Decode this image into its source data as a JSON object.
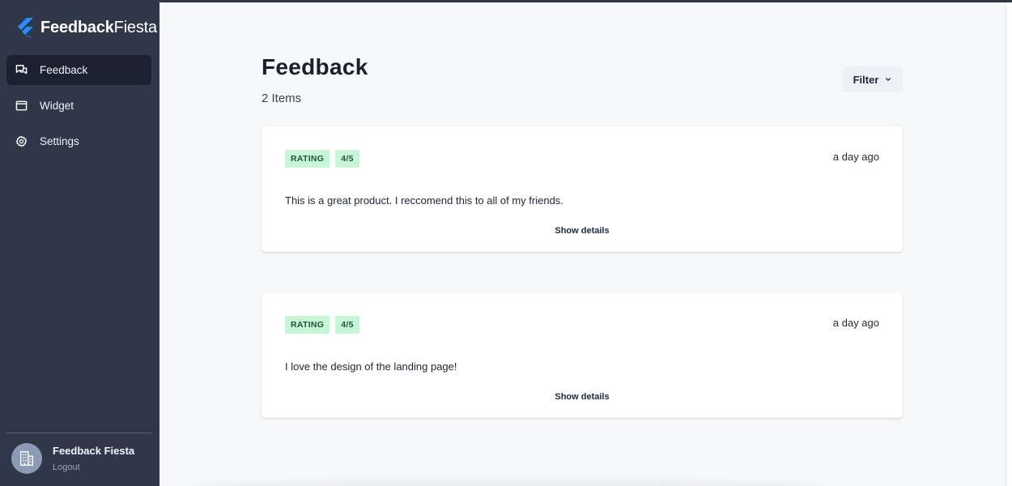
{
  "brand": {
    "name_bold": "Feedback",
    "name_light": "Fiesta"
  },
  "sidebar": {
    "items": [
      {
        "label": "Feedback",
        "icon": "chat-bubbles-icon",
        "active": true
      },
      {
        "label": "Widget",
        "icon": "window-icon",
        "active": false
      },
      {
        "label": "Settings",
        "icon": "gear-icon",
        "active": false
      }
    ],
    "user": {
      "name": "Feedback Fiesta",
      "logout": "Logout",
      "avatar_icon": "building-icon"
    }
  },
  "main": {
    "title": "Feedback",
    "count": "2 Items",
    "filter_label": "Filter",
    "cards": [
      {
        "badges": [
          "RATING",
          "4/5"
        ],
        "time": "a day ago",
        "message": "This is a great product. I reccomend this to all of my friends.",
        "details": "Show details"
      },
      {
        "badges": [
          "RATING",
          "4/5"
        ],
        "time": "a day ago",
        "message": "I love the design of the landing page!",
        "details": "Show details"
      }
    ]
  },
  "colors": {
    "sidebar": "#2f3749",
    "active_nav": "#1b2130",
    "badge_bg": "#c6f6d5",
    "badge_text": "#22543d",
    "brand_logo": "#2b8cff"
  }
}
